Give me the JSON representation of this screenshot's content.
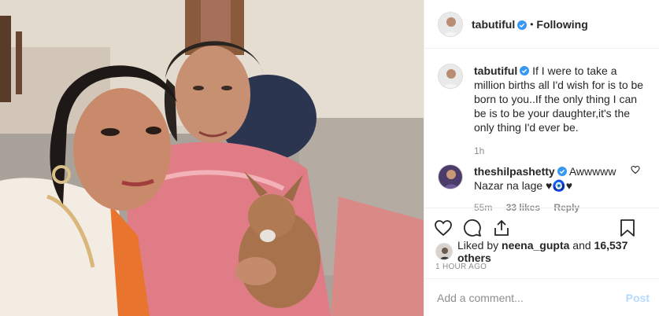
{
  "post": {
    "username": "tabutiful",
    "separator": "•",
    "follow_state": "Following",
    "caption": "If I were to take a million births all I'd wish for is to be born to you..If the only thing I can be is to be your daughter,it's the only thing I'd ever be.",
    "caption_age": "1h",
    "likes_prefix": "Liked by",
    "liked_by": "neena_gupta",
    "likes_joiner": "and",
    "likes_count": "16,537 others",
    "posted_ago": "1 HOUR AGO"
  },
  "comments": [
    {
      "username": "theshilpashetty",
      "text": "Awwwww Nazar na lage ♥🧿♥",
      "age": "55m",
      "likes": "33 likes",
      "reply_label": "Reply"
    }
  ],
  "add_comment": {
    "placeholder": "Add a comment...",
    "post_label": "Post"
  },
  "icons": {
    "verified": "verified-badge-icon",
    "like": "heart-icon",
    "comment": "comment-bubble-icon",
    "share": "share-icon",
    "save": "bookmark-icon"
  },
  "colors": {
    "verified_blue": "#3897f0",
    "post_button_disabled": "#b3dbff",
    "muted_text": "#8e8e8e"
  }
}
